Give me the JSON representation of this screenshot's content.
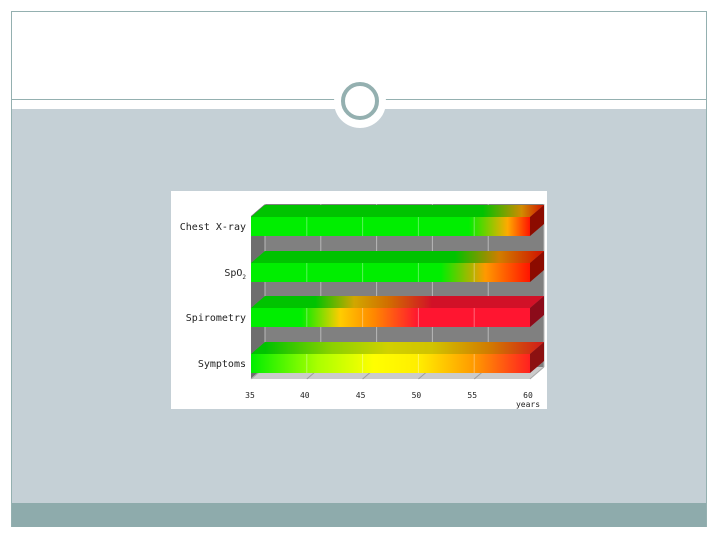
{
  "chart_data": {
    "type": "bar",
    "orientation": "horizontal-3d",
    "categories": [
      "Chest X-ray",
      "SpO",
      "Spirometry",
      "Symptoms"
    ],
    "category_subscript": [
      "",
      "2",
      "",
      ""
    ],
    "x_ticks": [
      "35",
      "40",
      "45",
      "50",
      "55",
      "60"
    ],
    "x_range": [
      35,
      60
    ],
    "x_unit_label": "years",
    "grid": true,
    "bars": [
      {
        "category": "Chest X-ray",
        "start": 35,
        "end": 60,
        "color_stops": [
          {
            "x": 35,
            "color": "#00ee00"
          },
          {
            "x": 54.5,
            "color": "#00ee00"
          },
          {
            "x": 58,
            "color": "#ffaa00"
          },
          {
            "x": 60,
            "color": "#ff1500"
          }
        ]
      },
      {
        "category": "SpO",
        "start": 35,
        "end": 60,
        "color_stops": [
          {
            "x": 35,
            "color": "#00ee00"
          },
          {
            "x": 52,
            "color": "#00ee00"
          },
          {
            "x": 56,
            "color": "#ff9900"
          },
          {
            "x": 60,
            "color": "#ff1500"
          }
        ]
      },
      {
        "category": "Spirometry",
        "start": 35,
        "end": 60,
        "color_stops": [
          {
            "x": 35,
            "color": "#00ee00"
          },
          {
            "x": 39.5,
            "color": "#00ee00"
          },
          {
            "x": 43,
            "color": "#ffcc00"
          },
          {
            "x": 46,
            "color": "#ff8800"
          },
          {
            "x": 50,
            "color": "#ff1530"
          },
          {
            "x": 60,
            "color": "#ff1530"
          }
        ]
      },
      {
        "category": "Symptoms",
        "start": 35,
        "end": 60,
        "color_stops": [
          {
            "x": 35,
            "color": "#00ee00"
          },
          {
            "x": 41,
            "color": "#aaff00"
          },
          {
            "x": 46,
            "color": "#ffff00"
          },
          {
            "x": 50,
            "color": "#ffee00"
          },
          {
            "x": 55,
            "color": "#ff9900"
          },
          {
            "x": 60,
            "color": "#ff2020"
          }
        ]
      }
    ]
  }
}
